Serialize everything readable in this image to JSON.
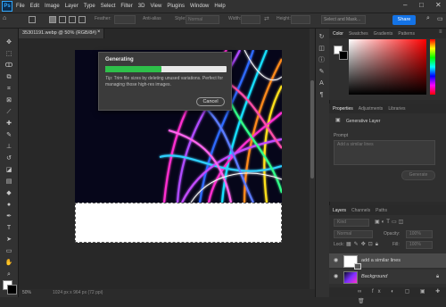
{
  "menubar": {
    "logo": "Ps",
    "items": [
      "File",
      "Edit",
      "Image",
      "Layer",
      "Type",
      "Select",
      "Filter",
      "3D",
      "View",
      "Plugins",
      "Window",
      "Help"
    ],
    "window_controls": [
      "–",
      "□",
      "✕"
    ]
  },
  "options": {
    "labels": [
      "Feather:",
      "Anti-alias",
      "Style:",
      "Normal",
      "Width:",
      "Height:"
    ],
    "select_and_mask": "Select and Mask...",
    "share_label": "Share"
  },
  "document": {
    "tab_title": "35301191.webp @ 50% (RGB/8#) *",
    "zoom": "50%",
    "doc_info": "1024 px x 964 px (72 ppi)"
  },
  "dialog": {
    "title": "Generating",
    "progress": 0.46,
    "tip_prefix": "Tip:",
    "tip_text": "Trim file sizes by deleting unused variations. Perfect for managing those high-res images.",
    "cancel_label": "Cancel"
  },
  "color_panel": {
    "tabs": [
      "Color",
      "Swatches",
      "Gradients",
      "Patterns"
    ],
    "foreground": "#ffffff",
    "background": "#000000",
    "hue": "#ff0000"
  },
  "properties_panel": {
    "tabs": [
      "Properties",
      "Adjustments",
      "Libraries"
    ],
    "layer_type": "Generative Layer",
    "prompt_label": "Prompt",
    "prompt_placeholder": "Add a similar lines",
    "generate_label": "Generate"
  },
  "layers_panel": {
    "tabs": [
      "Layers",
      "Channels",
      "Paths"
    ],
    "kind": "Kind",
    "blend_mode": "Normal",
    "opacity_label": "Opacity:",
    "opacity_value": "100%",
    "lock_label": "Lock:",
    "fill_label": "Fill:",
    "fill_value": "100%",
    "layers": [
      {
        "name": "add a similar lines",
        "italic": false
      },
      {
        "name": "Background",
        "italic": true
      }
    ]
  }
}
